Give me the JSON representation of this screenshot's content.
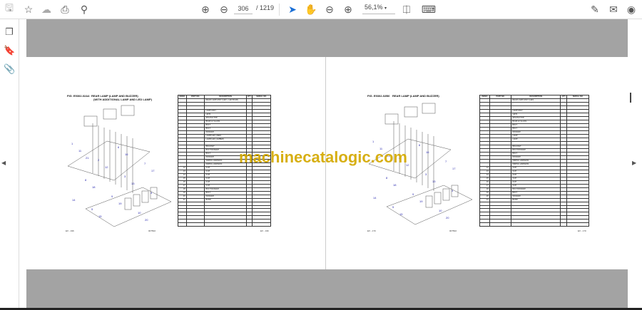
{
  "toolbar": {
    "current_page": "306",
    "total_pages": "/ 1219",
    "zoom": "56,1%",
    "colors": {
      "accent": "#1a6fd6"
    },
    "icons": [
      "save-icon",
      "bookmark-star-icon",
      "upload-cloud-icon",
      "print-icon",
      "search-zoom-icon",
      "page-up-icon",
      "page-down-icon",
      "select-cursor-icon",
      "hand-pan-icon",
      "zoom-out-icon",
      "zoom-in-icon",
      "page-fit-icon",
      "scroll-mode-icon",
      "sign-icon",
      "email-icon",
      "account-icon"
    ]
  },
  "sidebar": {
    "icons": [
      "pages-icon",
      "bookmarks-icon",
      "attachments-icon"
    ]
  },
  "watermark": "machinecatalogic.com",
  "pages": [
    {
      "fig": "FIG. E9302-02A4",
      "title": "REAR LAMP (LAMP AND BUZZER)",
      "subtitle": "(WITH ADDITIONAL LAMP AND LED LAMP)",
      "headers": [
        "INDEX",
        "PART NO.",
        "DESCRIPTION",
        "QTY",
        "SERIAL NO."
      ],
      "rows": [
        [
          "",
          "",
          "REAR LAMP ASSY (LED + LED BULB)"
        ],
        [
          "",
          "",
          ""
        ],
        [
          "",
          "",
          ""
        ],
        [
          "",
          "",
          "LAMP ASSY"
        ],
        [
          "",
          "",
          "LENS"
        ],
        [
          "",
          "",
          "SPLASH TOP"
        ],
        [
          "",
          "",
          "BULB 12 GLASS"
        ],
        [
          "",
          "",
          "BOLT"
        ],
        [
          "",
          "",
          "BOLT"
        ],
        [
          "",
          "",
          "WASHER"
        ],
        [
          "",
          "",
          "LAMP(LED) (RED)"
        ],
        [
          "",
          "",
          "LAMP(LED) (AMBER)"
        ],
        [
          "",
          "",
          ""
        ],
        [
          "",
          "",
          "BRACKET"
        ],
        [
          "",
          "",
          "BOLT,WASHER"
        ],
        [
          "",
          "",
          "BOLT"
        ],
        [
          "",
          "",
          "WASHER"
        ],
        [
          "",
          "",
          "WIRING HARNESS"
        ],
        [
          "",
          "",
          "WIRING HARNESS"
        ],
        [
          "12",
          "",
          "CLIP"
        ],
        [
          "13",
          "",
          "CLIP"
        ],
        [
          "14",
          "",
          "CLIP"
        ],
        [
          "15",
          "",
          "CLIP"
        ],
        [
          "16",
          "",
          "CLIP"
        ],
        [
          "17",
          "",
          "CLIP"
        ],
        [
          "18",
          "",
          "BOLT,WASHER"
        ],
        [
          "19",
          "",
          "BOLT"
        ],
        [
          "20",
          "",
          "WASHER"
        ],
        [
          "21",
          "",
          "BAND"
        ],
        [
          "",
          "",
          ""
        ],
        [
          "",
          "",
          ""
        ],
        [
          "",
          "",
          ""
        ],
        [
          "",
          "",
          ""
        ],
        [
          "",
          "",
          ""
        ],
        [
          "",
          "",
          ""
        ],
        [
          "",
          "",
          ""
        ]
      ],
      "footer_left": "EX - 196",
      "footer_mid": "007502",
      "footer_right": "EX - 196"
    },
    {
      "fig": "FIG. E9302-02B0",
      "title": "REAR LAMP (LAMP AND BUZZER)",
      "subtitle": "",
      "headers": [
        "INDEX",
        "PART NO.",
        "DESCRIPTION",
        "QTY",
        "SERIAL NO."
      ],
      "rows": [
        [
          "",
          "",
          "REAR LAMP ASSY (LED)"
        ],
        [
          "",
          "",
          ""
        ],
        [
          "",
          "",
          ""
        ],
        [
          "",
          "",
          "LAMP ASSY"
        ],
        [
          "",
          "",
          "LENS"
        ],
        [
          "",
          "",
          "SPLASH TOP"
        ],
        [
          "",
          "",
          "BULB 12 GLASS"
        ],
        [
          "",
          "",
          "BOLT"
        ],
        [
          "",
          "",
          "BOLT"
        ],
        [
          "",
          "",
          "WASHER"
        ],
        [
          "",
          "",
          "LAMP"
        ],
        [
          "",
          "",
          "LAMP"
        ],
        [
          "",
          "",
          ""
        ],
        [
          "",
          "",
          "BRACKET"
        ],
        [
          "",
          "",
          "BOLT,WASHER"
        ],
        [
          "",
          "",
          "BOLT"
        ],
        [
          "",
          "",
          "WASHER"
        ],
        [
          "",
          "",
          "WIRING HARNESS"
        ],
        [
          "",
          "",
          "WIRING HARNESS"
        ],
        [
          "12",
          "",
          "CLIP"
        ],
        [
          "13",
          "",
          "CLIP"
        ],
        [
          "14",
          "",
          "CLIP"
        ],
        [
          "15",
          "",
          "CLIP"
        ],
        [
          "16",
          "",
          "CLIP"
        ],
        [
          "17",
          "",
          "CLIP"
        ],
        [
          "18",
          "",
          "BOLT,WASHER"
        ],
        [
          "19",
          "",
          "BOLT"
        ],
        [
          "20",
          "",
          "WASHER"
        ],
        [
          "21",
          "",
          "BAND"
        ],
        [
          "",
          "",
          ""
        ],
        [
          "",
          "",
          ""
        ],
        [
          "",
          "",
          ""
        ],
        [
          "",
          "",
          ""
        ],
        [
          "",
          "",
          ""
        ],
        [
          "",
          "",
          ""
        ],
        [
          "",
          "",
          ""
        ]
      ],
      "footer_left": "EX - 170",
      "footer_mid": "007502",
      "footer_right": "EX - 170"
    }
  ]
}
